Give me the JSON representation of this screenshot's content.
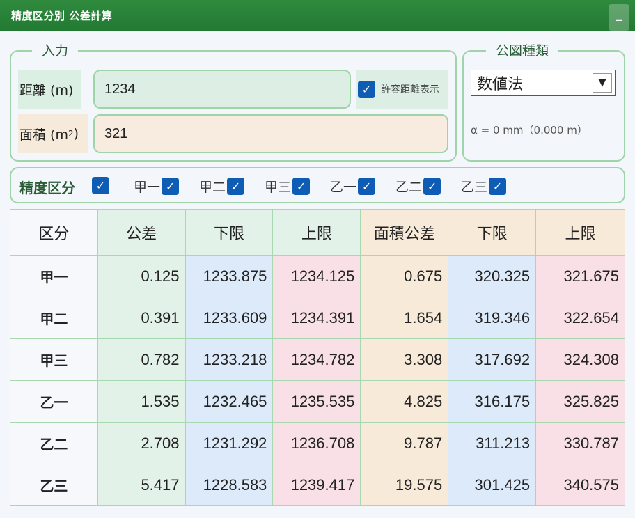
{
  "window": {
    "title": "精度区分別 公差計算",
    "minimize_label": "_"
  },
  "input_panel": {
    "legend": "入力",
    "distance_label": "距離 (m)",
    "distance_value": "1234",
    "area_label_prefix": "面積 (m",
    "area_label_sup": "2",
    "area_label_suffix": ")",
    "area_value": "321",
    "show_tolerance_label": "許容距離表示",
    "show_tolerance_checked": true
  },
  "map_type_panel": {
    "legend": "公図種類",
    "selected": "数値法",
    "alpha_text": "α = 0 mm（0.000 m）"
  },
  "grades": {
    "title": "精度区分",
    "items": [
      {
        "label": "甲一",
        "checked": true
      },
      {
        "label": "甲二",
        "checked": true
      },
      {
        "label": "甲三",
        "checked": true
      },
      {
        "label": "乙一",
        "checked": true
      },
      {
        "label": "乙二",
        "checked": true
      },
      {
        "label": "乙三",
        "checked": true
      }
    ]
  },
  "table": {
    "headers": [
      "区分",
      "公差",
      "下限",
      "上限",
      "面積公差",
      "下限",
      "上限"
    ],
    "rows": [
      [
        "甲一",
        "0.125",
        "1233.875",
        "1234.125",
        "0.675",
        "320.325",
        "321.675"
      ],
      [
        "甲二",
        "0.391",
        "1233.609",
        "1234.391",
        "1.654",
        "319.346",
        "322.654"
      ],
      [
        "甲三",
        "0.782",
        "1233.218",
        "1234.782",
        "3.308",
        "317.692",
        "324.308"
      ],
      [
        "乙一",
        "1.535",
        "1232.465",
        "1235.535",
        "4.825",
        "316.175",
        "325.825"
      ],
      [
        "乙二",
        "2.708",
        "1231.292",
        "1236.708",
        "9.787",
        "311.213",
        "330.787"
      ],
      [
        "乙三",
        "5.417",
        "1228.583",
        "1239.417",
        "19.575",
        "301.425",
        "340.575"
      ]
    ]
  },
  "colors": {
    "title_bar": "#237a33",
    "accent": "#0f5cb5",
    "border": "#9fd3a8"
  }
}
